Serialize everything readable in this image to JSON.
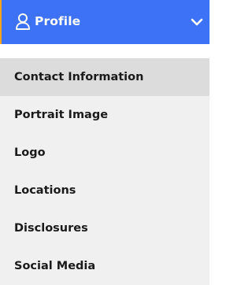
{
  "header": {
    "title": "Profile",
    "icon": "user-icon",
    "toggle_icon": "chevron-down-icon",
    "colors": {
      "background": "#3d71f6",
      "accent_border": "#f7a51d",
      "text": "#ffffff"
    }
  },
  "menu": {
    "active_index": 0,
    "items": [
      {
        "label": "Contact Information"
      },
      {
        "label": "Portrait Image"
      },
      {
        "label": "Logo"
      },
      {
        "label": "Locations"
      },
      {
        "label": "Disclosures"
      },
      {
        "label": "Social Media"
      }
    ],
    "colors": {
      "background": "#f0f0f0",
      "active_background": "#dcdcdc",
      "text": "#1a1a1a"
    }
  }
}
